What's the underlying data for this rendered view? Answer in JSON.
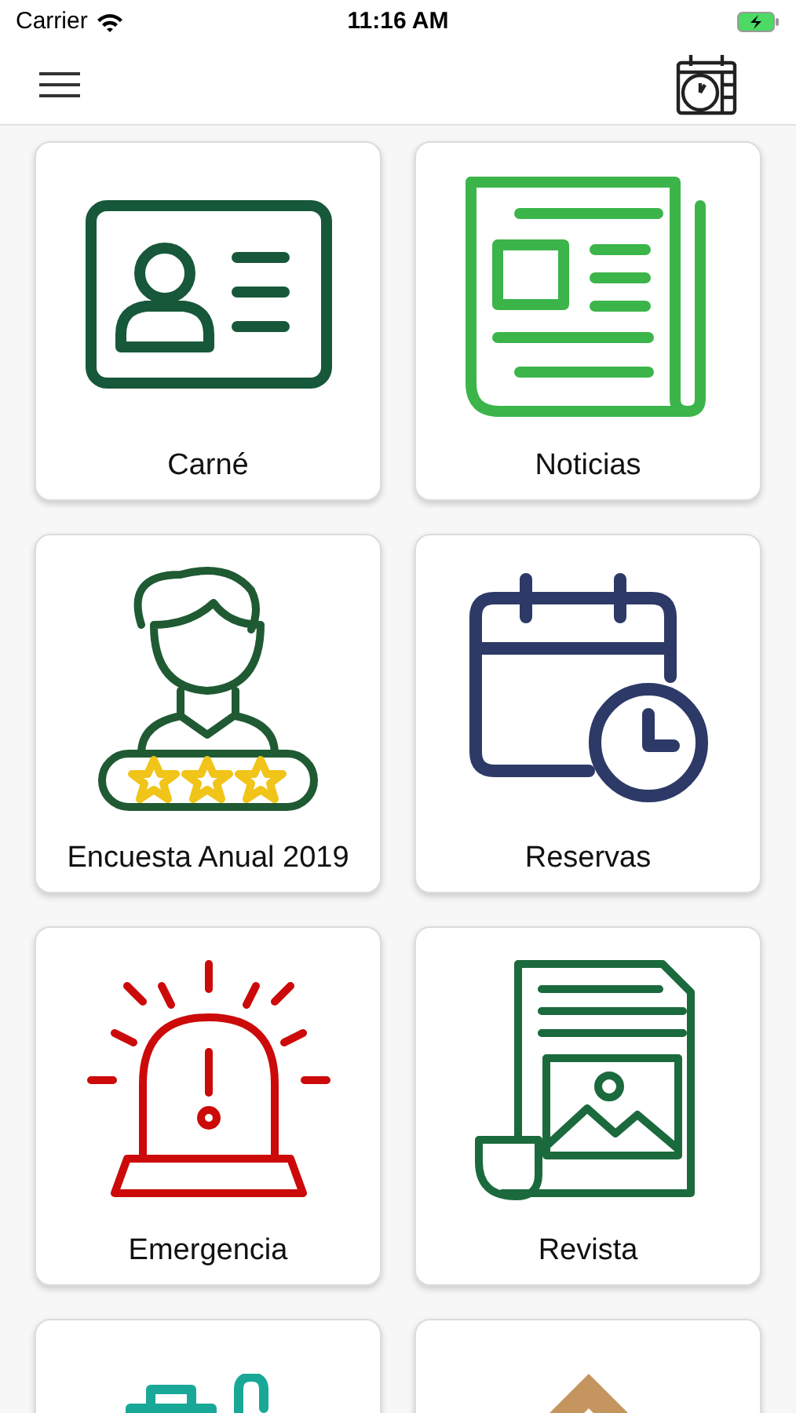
{
  "status_bar": {
    "carrier": "Carrier",
    "time": "11:16 AM"
  },
  "tiles": [
    {
      "label": "Carné"
    },
    {
      "label": "Noticias"
    },
    {
      "label": "Encuesta Anual 2019"
    },
    {
      "label": "Reservas"
    },
    {
      "label": "Emergencia"
    },
    {
      "label": "Revista"
    },
    {
      "kind": "partial"
    },
    {
      "kind": "partial"
    }
  ]
}
